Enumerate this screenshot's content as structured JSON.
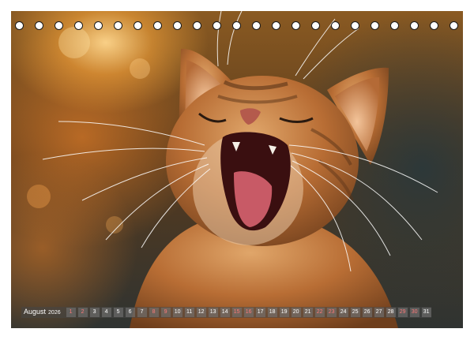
{
  "photo": {
    "subject": "cat-photo"
  },
  "calendar": {
    "month": "August",
    "year": "2026",
    "days": [
      {
        "n": "1",
        "weekend": true
      },
      {
        "n": "2",
        "weekend": true
      },
      {
        "n": "3",
        "weekend": false
      },
      {
        "n": "4",
        "weekend": false
      },
      {
        "n": "5",
        "weekend": false
      },
      {
        "n": "6",
        "weekend": false
      },
      {
        "n": "7",
        "weekend": false
      },
      {
        "n": "8",
        "weekend": true
      },
      {
        "n": "9",
        "weekend": true
      },
      {
        "n": "10",
        "weekend": false
      },
      {
        "n": "11",
        "weekend": false
      },
      {
        "n": "12",
        "weekend": false
      },
      {
        "n": "13",
        "weekend": false
      },
      {
        "n": "14",
        "weekend": false
      },
      {
        "n": "15",
        "weekend": true
      },
      {
        "n": "16",
        "weekend": true
      },
      {
        "n": "17",
        "weekend": false
      },
      {
        "n": "18",
        "weekend": false
      },
      {
        "n": "19",
        "weekend": false
      },
      {
        "n": "20",
        "weekend": false
      },
      {
        "n": "21",
        "weekend": false
      },
      {
        "n": "22",
        "weekend": true
      },
      {
        "n": "23",
        "weekend": true
      },
      {
        "n": "24",
        "weekend": false
      },
      {
        "n": "25",
        "weekend": false
      },
      {
        "n": "26",
        "weekend": false
      },
      {
        "n": "27",
        "weekend": false
      },
      {
        "n": "28",
        "weekend": false
      },
      {
        "n": "29",
        "weekend": true
      },
      {
        "n": "30",
        "weekend": true
      },
      {
        "n": "31",
        "weekend": false
      }
    ]
  },
  "colors": {
    "weekend": "#ff7a7a",
    "weekday": "#ffffff"
  }
}
